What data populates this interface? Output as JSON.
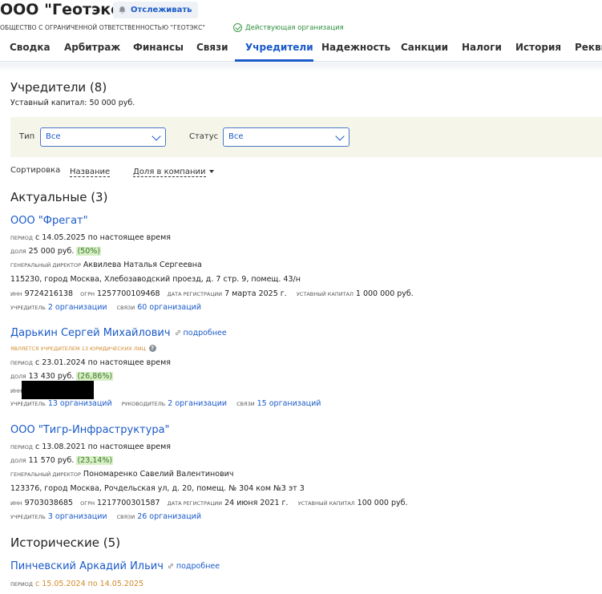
{
  "header": {
    "title": "ООО \"Геотэкс\"",
    "follow_label": "Отслеживать",
    "full_name": "ОБЩЕСТВО С ОГРАНИЧЕННОЙ ОТВЕТСТВЕННОСТЬЮ \"ГЕОТЭКС\"",
    "status": "Действующая организация"
  },
  "tabs": [
    {
      "label": "Сводка"
    },
    {
      "label": "Арбитраж"
    },
    {
      "label": "Финансы"
    },
    {
      "label": "Связи"
    },
    {
      "label": "Учредители"
    },
    {
      "label": "Надежность"
    },
    {
      "label": "Санкции"
    },
    {
      "label": "Налоги"
    },
    {
      "label": "История"
    },
    {
      "label": "Рекви"
    }
  ],
  "active_tab": "Учредители",
  "section": {
    "title": "Учредители (8)",
    "capital": "Уставный капитал: 50 000 руб."
  },
  "filters": {
    "type_label": "Тип",
    "type_value": "Все",
    "status_label": "Статус",
    "status_value": "Все"
  },
  "sort": {
    "label": "Сортировка",
    "by_name": "Название",
    "by_share": "Доля в компании"
  },
  "actual_title": "Актуальные (3)",
  "historic_title": "Исторические (5)",
  "labels": {
    "period": "период",
    "share": "доля",
    "director": "генеральный директор",
    "inn": "инн",
    "ogrn": "огрн",
    "reg_date": "дата регистрации",
    "capital": "уставный капитал",
    "founder": "учредитель",
    "links": "связи",
    "head": "руководитель",
    "more": "подробнее"
  },
  "founders": [
    {
      "name": "ООО \"Фрегат\"",
      "period": "с 14.05.2025 по настоящее время",
      "share": "25 000 руб.",
      "share_pct": "(50%)",
      "director": "Аквилева Наталья Сергеевна",
      "address": "115230, город Москва, Хлебозаводский проезд, д. 7 стр. 9, помещ. 43/н",
      "inn": "9724216138",
      "ogrn": "1257700109468",
      "reg_date": "7 марта 2025 г.",
      "capital": "1 000 000 руб.",
      "founder_of": "2 организации",
      "links": "60 организаций"
    },
    {
      "name": "Дарькин Сергей Михайлович",
      "note": "является учредителем 13 юридических лиц",
      "period": "с 23.01.2024 по настоящее время",
      "share": "13 430 руб.",
      "share_pct": "(26,86%)",
      "founder_of": "13 организаций",
      "head_of": "2 организации",
      "links": "15 организаций"
    },
    {
      "name": "ООО \"Тигр-Инфраструктура\"",
      "period": "с 13.08.2021 по настоящее время",
      "share": "11 570 руб.",
      "share_pct": "(23,14%)",
      "director": "Пономаренко Савелий Валентинович",
      "address": "123376, город Москва, Рочдельская ул, д. 20, помещ. № 304 ком №3 эт 3",
      "inn": "9703038685",
      "ogrn": "1217700301587",
      "reg_date": "24 июня 2021 г.",
      "capital": "100 000 руб.",
      "founder_of": "3 организации",
      "links": "26 организаций"
    }
  ],
  "historic": [
    {
      "name": "Пинчевский Аркадий Ильич",
      "period": "с 15.05.2024 по 14.05.2025"
    }
  ]
}
